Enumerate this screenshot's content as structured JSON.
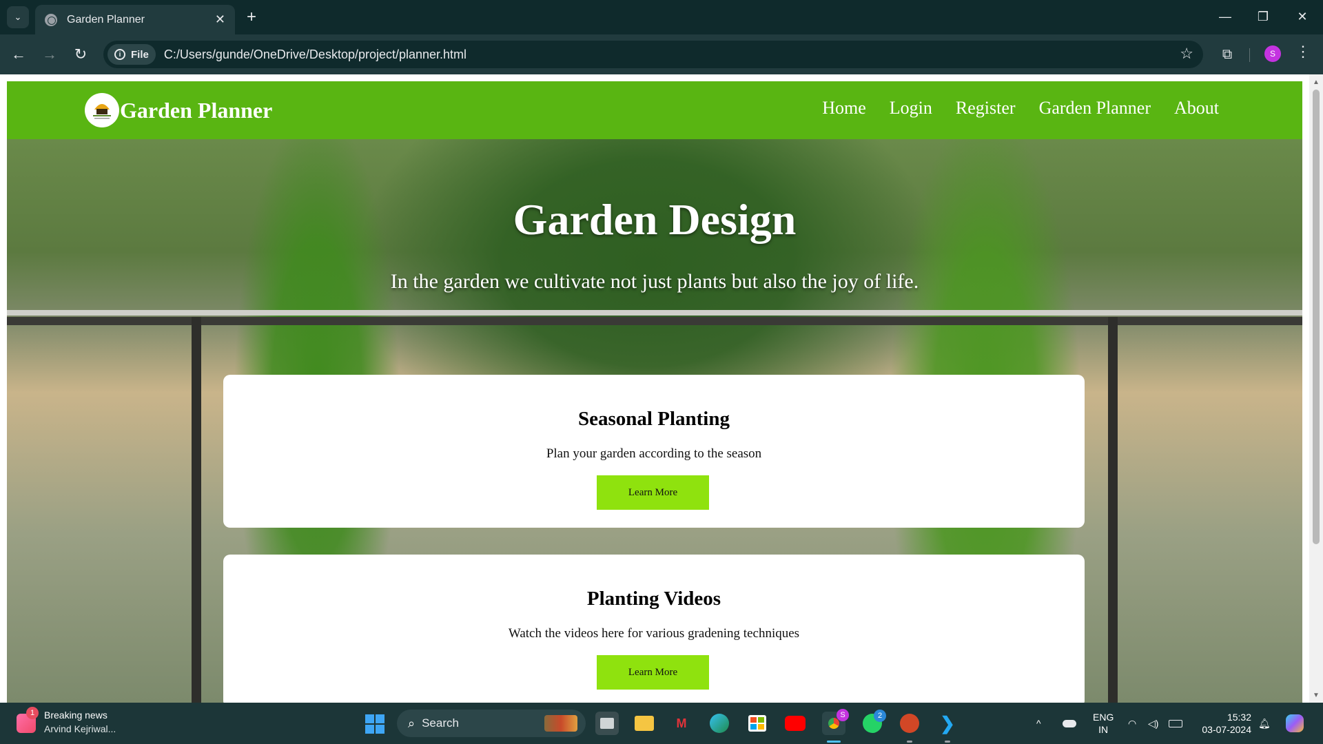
{
  "browser": {
    "tab_title": "Garden Planner",
    "tab_close": "✕",
    "new_tab": "+",
    "tab_search": "⌄",
    "window": {
      "minimize": "—",
      "restore": "❐",
      "close": "✕"
    },
    "nav": {
      "back": "←",
      "forward": "→",
      "reload": "↻"
    },
    "site_info_label": "File",
    "url": "C:/Users/gunde/OneDrive/Desktop/project/planner.html",
    "bookmark_icon": "☆",
    "extensions_icon": "⧉",
    "profile_initial": "S",
    "menu_icon": "⋮"
  },
  "site": {
    "brand": "Garden Planner",
    "nav_links": [
      "Home",
      "Login",
      "Register",
      "Garden Planner",
      "About"
    ],
    "hero": {
      "title": "Garden Design",
      "subtitle": "In the garden we cultivate not just plants but also the joy of life."
    },
    "cards": [
      {
        "title": "Seasonal Planting",
        "text": "Plan your garden according to the season",
        "button": "Learn More"
      },
      {
        "title": "Planting Videos",
        "text": "Watch the videos here for various gradening techniques",
        "button": "Learn More"
      }
    ],
    "colors": {
      "nav_bg": "#59b512",
      "button_bg": "#8fe20e"
    }
  },
  "taskbar": {
    "news_badge": "1",
    "news_title": "Breaking news",
    "news_sub": "Arvind Kejriwal...",
    "search_label": "Search",
    "chrome_badge": "S",
    "whatsapp_badge": "2",
    "lang_top": "ENG",
    "lang_bottom": "IN",
    "time": "15:32",
    "date": "03-07-2024",
    "tray_chevron": "^"
  }
}
